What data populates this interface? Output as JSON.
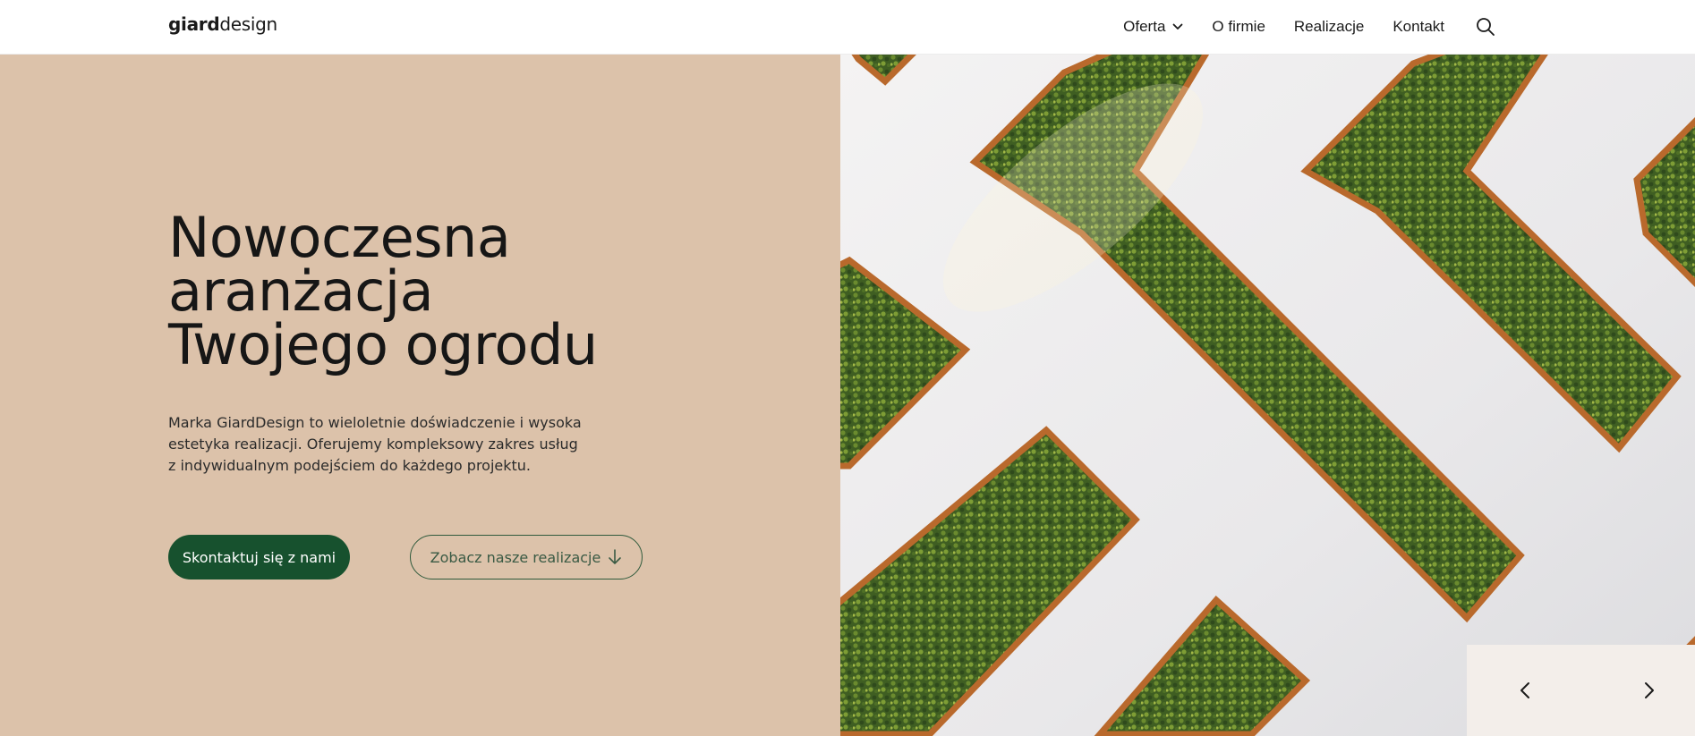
{
  "header": {
    "logo": {
      "bold": "giard",
      "light": "design"
    },
    "nav": [
      {
        "label": "Oferta",
        "has_dropdown": true
      },
      {
        "label": "O firmie"
      },
      {
        "label": "Realizacje"
      },
      {
        "label": "Kontakt"
      }
    ],
    "search_icon": "search-icon"
  },
  "hero": {
    "title_lines": [
      "Nowoczesna",
      "aranżacja",
      "Twojego ogrodu"
    ],
    "description_lines": [
      "Marka GiardDesign to wieloletnie doświadczenie i wysoka",
      "estetyka realizacji. Oferujemy kompleksowy zakres usług",
      "z indywidualnym podejściem do każdego projektu."
    ],
    "primary_button": "Skontaktuj się z nami",
    "secondary_button": "Zobacz nasze realizacje",
    "secondary_button_icon": "arrow-down-icon"
  },
  "slider": {
    "prev_icon": "chevron-left-icon",
    "next_icon": "chevron-right-icon"
  },
  "colors": {
    "hero_bg": "#dcc2aa",
    "primary": "#17512e",
    "slider_controls_bg": "#f3eeea",
    "planter_wood": "#b96a2c",
    "greenery": "#4a6a24"
  }
}
